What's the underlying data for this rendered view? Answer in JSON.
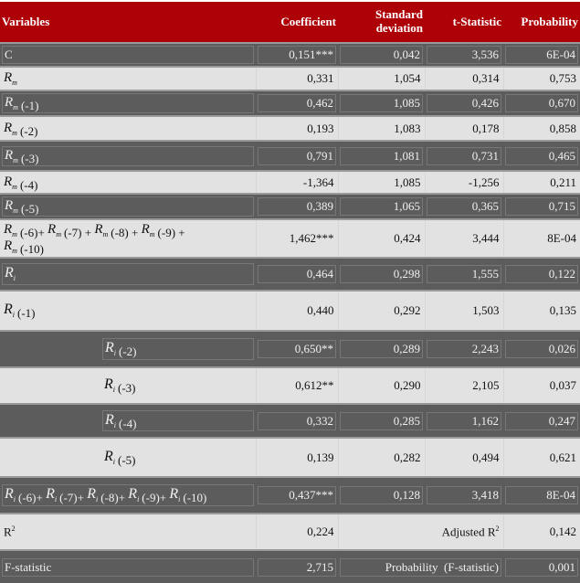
{
  "table": {
    "headers": {
      "variables": "Variables",
      "coefficient": "Coefficient",
      "std_line1": "Standard",
      "std_line2": "deviation",
      "t_stat": "t-Statistic",
      "probability": "Probability"
    },
    "rows": [
      {
        "variable": "C",
        "coefficient": "0,151***",
        "std": "0,042",
        "t": "3,536",
        "p": "6E-04"
      },
      {
        "var_sym": "R",
        "var_sub": "m",
        "lag": "",
        "coefficient": "0,331",
        "std": "1,054",
        "t": "0,314",
        "p": "0,753"
      },
      {
        "var_sym": "R",
        "var_sub": "m",
        "lag": "(-1)",
        "coefficient": "0,462",
        "std": "1,085",
        "t": "0,426",
        "p": "0,670"
      },
      {
        "var_sym": "R",
        "var_sub": "m",
        "lag": "(-2)",
        "coefficient": "0,193",
        "std": "1,083",
        "t": "0,178",
        "p": "0,858"
      },
      {
        "var_sym": "R",
        "var_sub": "m",
        "lag": "(-3)",
        "coefficient": "0,791",
        "std": "1,081",
        "t": "0,731",
        "p": "0,465"
      },
      {
        "var_sym": "R",
        "var_sub": "m",
        "lag": "(-4)",
        "coefficient": "-1,364",
        "std": "1,085",
        "t": "-1,256",
        "p": "0,211"
      },
      {
        "var_sym": "R",
        "var_sub": "m",
        "lag": "(-5)",
        "coefficient": "0,389",
        "std": "1,065",
        "t": "0,365",
        "p": "0,715"
      },
      {
        "var_sym": "R",
        "var_sub": "m",
        "lags": [
          "(-6)+",
          "(-7) +",
          "(-8) +",
          "(-9) +",
          "(-10)"
        ],
        "coefficient": "1,462***",
        "std": "0,424",
        "t": "3,444",
        "p": "8E-04"
      },
      {
        "var_sym": "R",
        "var_sub": "i",
        "lag": "",
        "coefficient": "0,464",
        "std": "0,298",
        "t": "1,555",
        "p": "0,122"
      },
      {
        "var_sym": "R",
        "var_sub": "i",
        "lag": "(-1)",
        "coefficient": "0,440",
        "std": "0,292",
        "t": "1,503",
        "p": "0,135"
      },
      {
        "var_sym": "R",
        "var_sub": "i",
        "lag": "(-2)",
        "coefficient": "0,650**",
        "std": "0,289",
        "t": "2,243",
        "p": "0,026"
      },
      {
        "var_sym": "R",
        "var_sub": "i",
        "lag": "(-3)",
        "coefficient": "0,612**",
        "std": "0,290",
        "t": "2,105",
        "p": "0,037"
      },
      {
        "var_sym": "R",
        "var_sub": "i",
        "lag": "(-4)",
        "coefficient": "0,332",
        "std": "0,285",
        "t": "1,162",
        "p": "0,247"
      },
      {
        "var_sym": "R",
        "var_sub": "i",
        "lag": "(-5)",
        "coefficient": "0,139",
        "std": "0,282",
        "t": "0,494",
        "p": "0,621"
      },
      {
        "var_sym": "R",
        "var_sub": "i",
        "lags": [
          "(-6)+",
          "(-7)+",
          "(-8)+",
          "(-9)+",
          "(-10)"
        ],
        "coefficient": "0,437***",
        "std": "0,128",
        "t": "3,418",
        "p": "8E-04"
      }
    ],
    "stats": {
      "r2_label": "R",
      "r2_sup": "2",
      "r2_value": "0,224",
      "adj_r2_label": "Adjusted R",
      "adj_r2_sup": "2",
      "adj_r2_value": "0,142",
      "f_label": "F-statistic",
      "f_value": "2,715",
      "prob_f_label": "Probability  (F-statistic)",
      "prob_f_value": "0,001"
    }
  },
  "colors": {
    "header_bg": "#ad0007",
    "dark_row": "#5c5c5c",
    "light_row": "#e2e2e2"
  }
}
